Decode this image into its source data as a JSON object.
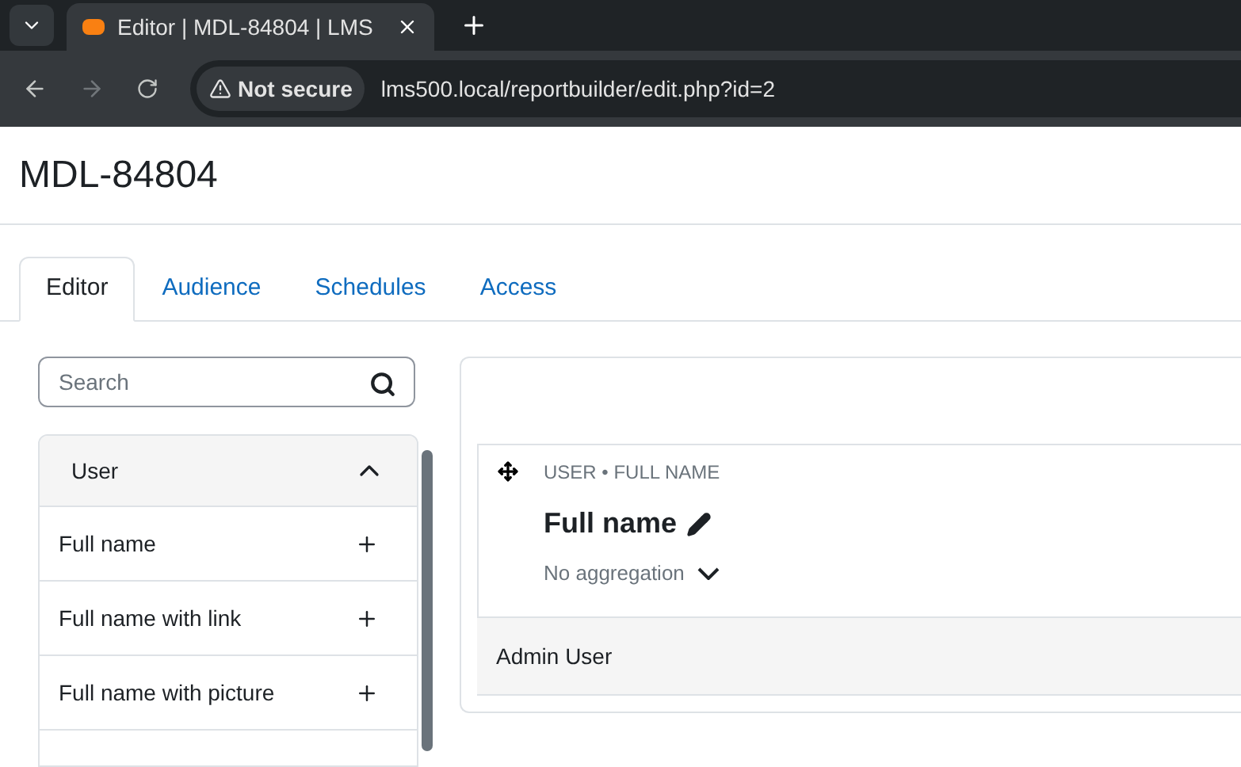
{
  "browser": {
    "tab_title": "Editor | MDL-84804 | LMS",
    "security": "Not secure",
    "url": "lms500.local/reportbuilder/edit.php?id=2"
  },
  "page_title": "MDL-84804",
  "tabs": [
    {
      "label": "Editor",
      "selected": true
    },
    {
      "label": "Audience",
      "selected": false
    },
    {
      "label": "Schedules",
      "selected": false
    },
    {
      "label": "Access",
      "selected": false
    }
  ],
  "search": {
    "placeholder": "Search"
  },
  "source_group": {
    "label": "User",
    "expanded": true,
    "items": [
      "Full name",
      "Full name with link",
      "Full name with picture"
    ]
  },
  "column": {
    "source": "USER • FULL NAME",
    "heading": "Full name",
    "aggregation": "No aggregation"
  },
  "rows": [
    "Admin User"
  ]
}
